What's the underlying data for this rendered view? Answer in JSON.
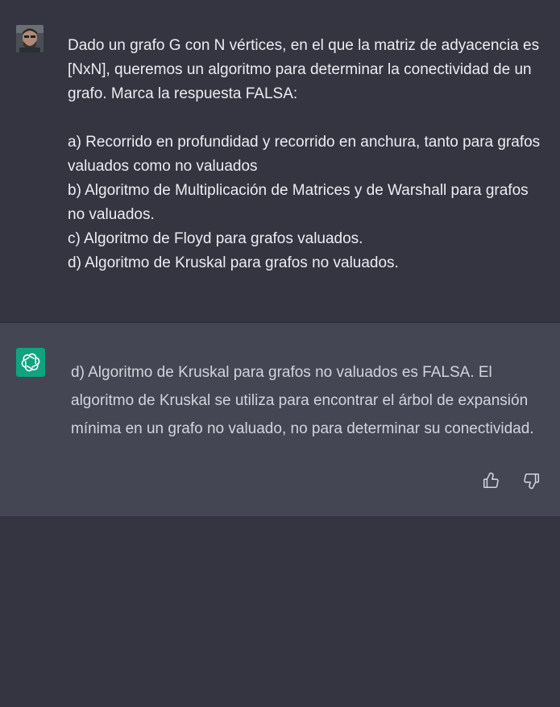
{
  "conversation": {
    "user_message": {
      "lines": [
        "Dado un grafo G con N vértices, en el que la matriz de adyacencia es [NxN], queremos un algoritmo para determinar la conectividad de un grafo. Marca la respuesta FALSA:",
        "a) Recorrido en profundidad y recorrido en anchura, tanto para grafos valuados como no valuados",
        "b) Algoritmo de Multiplicación de Matrices y de Warshall para grafos no valuados.",
        "c) Algoritmo de Floyd para grafos valuados.",
        "d) Algoritmo de Kruskal para grafos no valuados."
      ]
    },
    "assistant_message": {
      "text": "d) Algoritmo de Kruskal para grafos no valuados es FALSA. El algoritmo de Kruskal se utiliza para encontrar el árbol de expansión mínima en un grafo no valuado, no para determinar su conectividad."
    }
  },
  "icons": {
    "user_avatar": "user-avatar-photo",
    "assistant_avatar": "openai-logo-icon",
    "like": "thumbs-up-icon",
    "dislike": "thumbs-down-icon"
  },
  "colors": {
    "page_bg": "#343541",
    "assistant_bg": "#444654",
    "assistant_avatar_bg": "#10a37f",
    "text_primary": "#ececf1",
    "text_secondary": "#d1d5db"
  }
}
